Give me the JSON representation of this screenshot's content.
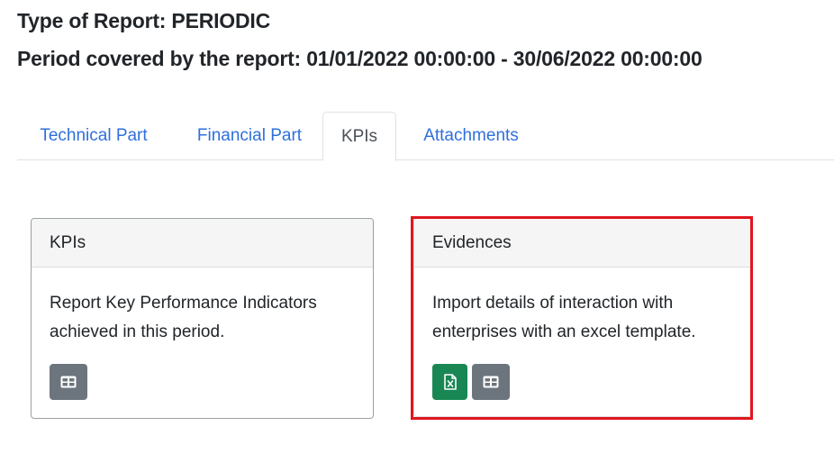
{
  "report": {
    "type_label": "Type of Report: PERIODIC",
    "period_label": "Period covered by the report: 01/01/2022 00:00:00 - 30/06/2022 00:00:00"
  },
  "tabs": [
    {
      "label": "Technical Part",
      "active": false
    },
    {
      "label": "Financial Part",
      "active": false
    },
    {
      "label": "KPIs",
      "active": true
    },
    {
      "label": "Attachments",
      "active": false
    }
  ],
  "cards": {
    "kpis": {
      "title": "KPIs",
      "text": "Report Key Performance Indicators achieved in this period.",
      "buttons": [
        {
          "icon": "table-icon",
          "color": "#6c757d"
        }
      ]
    },
    "evidences": {
      "title": "Evidences",
      "text": "Import details of interaction with enterprises with an excel template.",
      "highlighted": true,
      "highlight_color": "#e0161e",
      "buttons": [
        {
          "icon": "excel-file-icon",
          "color": "#198754"
        },
        {
          "icon": "table-icon",
          "color": "#6c757d"
        }
      ]
    }
  },
  "colors": {
    "link": "#2f6fdc",
    "active_tab_text": "#495057",
    "secondary_button": "#6c757d",
    "success_button": "#198754"
  }
}
